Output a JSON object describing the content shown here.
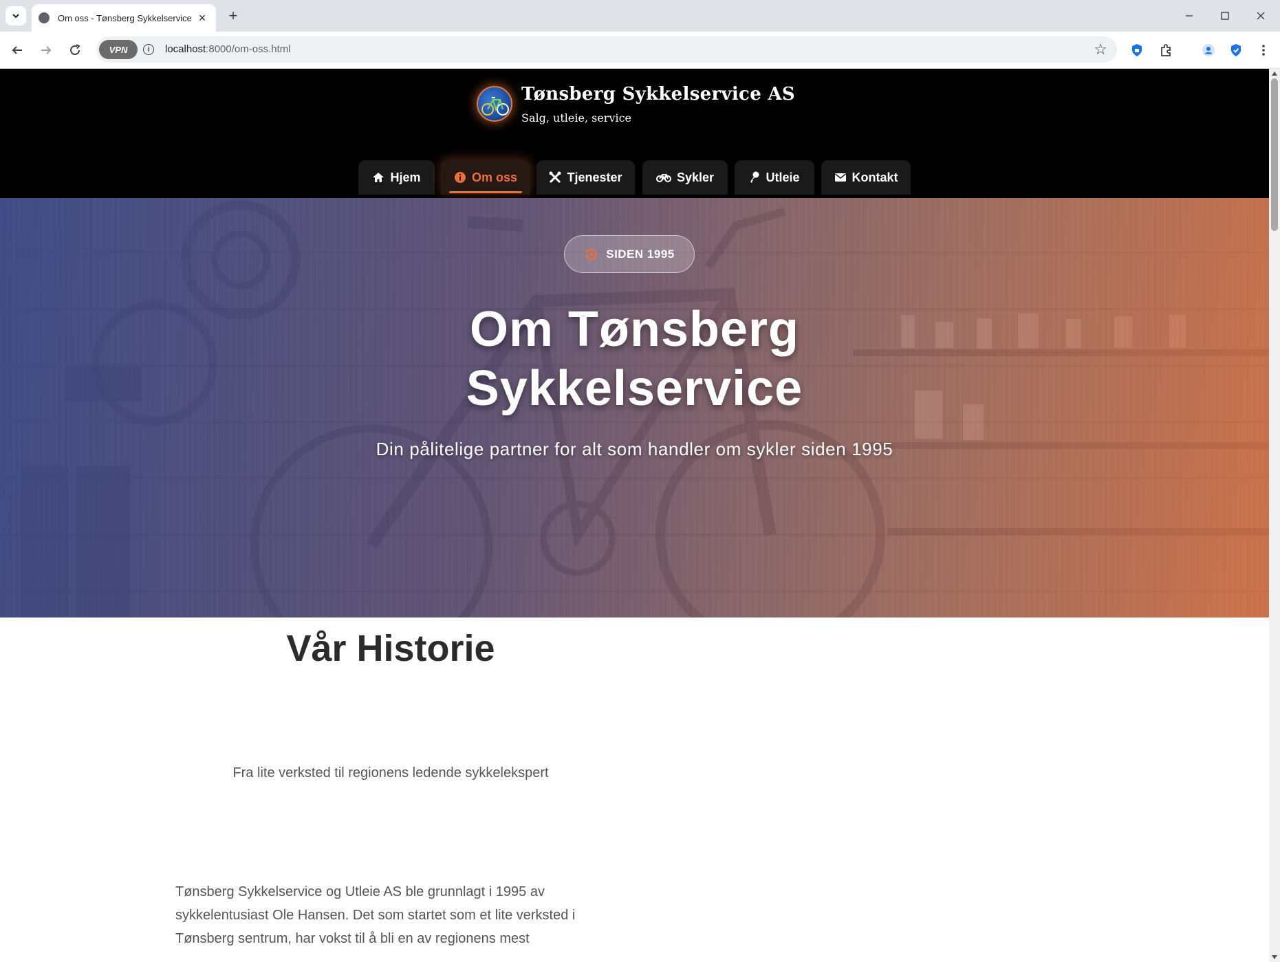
{
  "browser": {
    "tab_title": "Om oss - Tønsberg Sykkelservice og",
    "url_host": "localhost",
    "url_path": ":8000/om-oss.html",
    "vpn_label": "VPN"
  },
  "site": {
    "brand_title": "Tønsberg Sykkelservice AS",
    "brand_subtitle": "Salg, utleie, service"
  },
  "nav": {
    "items": [
      {
        "label": "Hjem",
        "icon": "home-icon"
      },
      {
        "label": "Om oss",
        "icon": "info-icon",
        "active": true
      },
      {
        "label": "Tjenester",
        "icon": "tools-icon"
      },
      {
        "label": "Sykler",
        "icon": "bicycle-icon"
      },
      {
        "label": "Utleie",
        "icon": "key-icon"
      },
      {
        "label": "Kontakt",
        "icon": "envelope-icon"
      }
    ]
  },
  "hero": {
    "badge": "SIDEN 1995",
    "title_line1": "Om Tønsberg",
    "title_line2": "Sykkelservice",
    "subtitle": "Din pålitelige partner for alt som handler om sykler siden 1995"
  },
  "history": {
    "title": "Vår Historie",
    "subtitle": "Fra lite verksted til regionens ledende sykkelekspert",
    "body_line1": "Tønsberg Sykkelservice og Utleie AS ble grunnlagt i 1995 av",
    "body_line2": "sykkelentusiast Ole Hansen. Det som startet som et lite verksted i",
    "body_line3": "Tønsberg sentrum, har vokst til å bli en av regionens mest"
  },
  "colors": {
    "accent": "#ee6f3a",
    "header_bg": "#000000",
    "heading_text": "#2b2b2b",
    "body_text": "#555555"
  }
}
